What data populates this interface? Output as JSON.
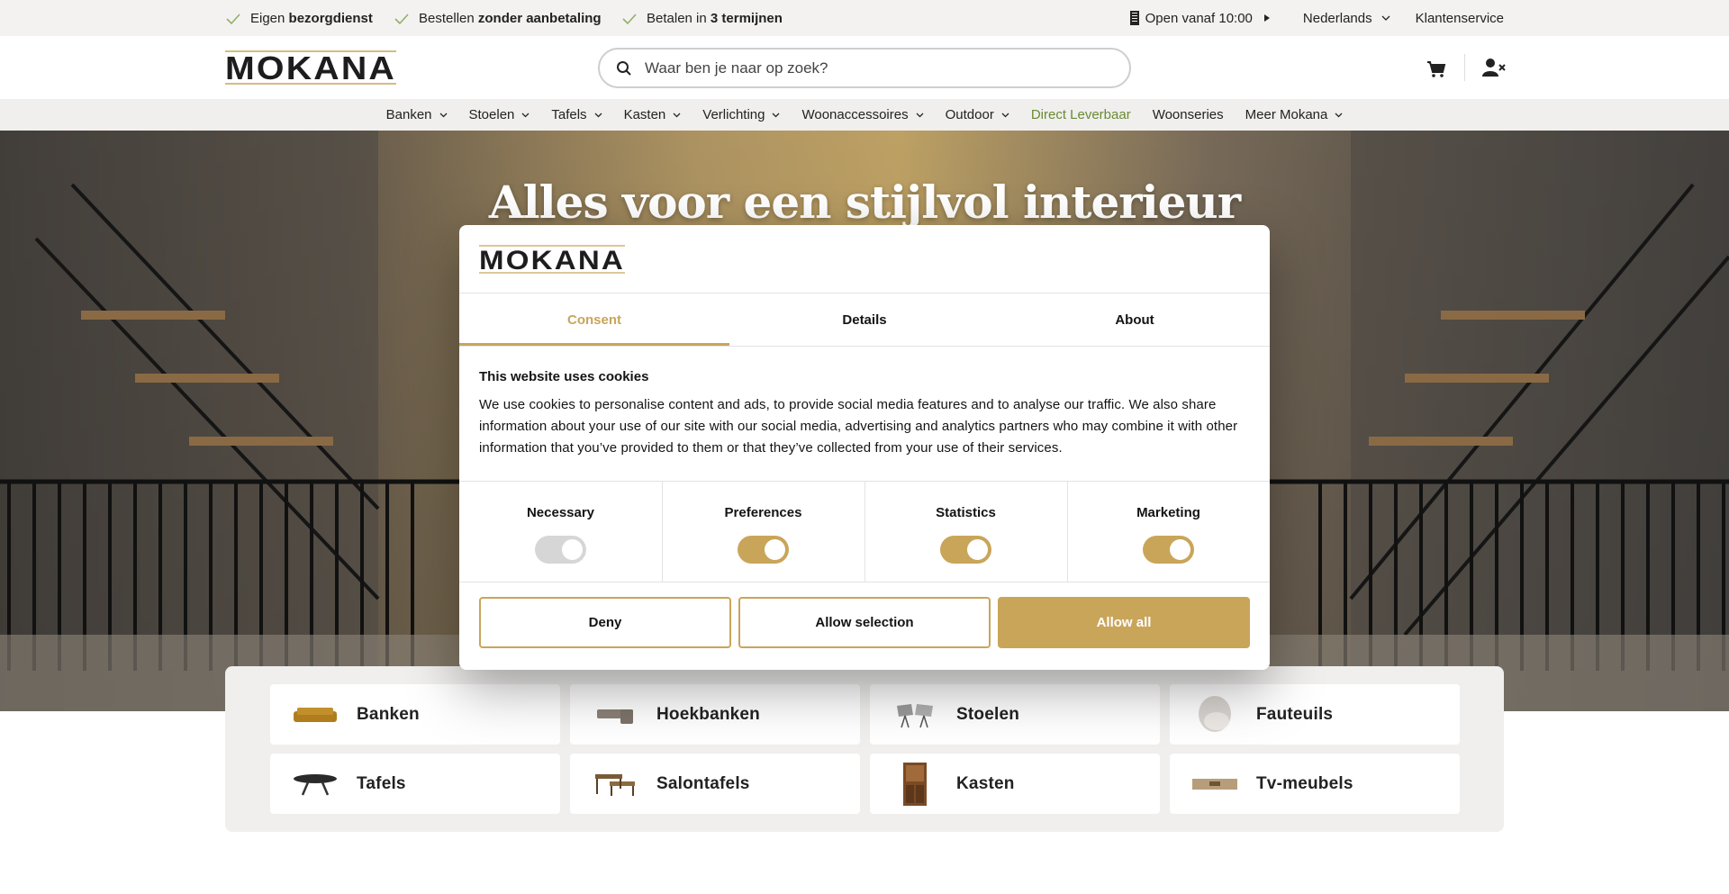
{
  "topbar": {
    "usps": [
      {
        "prefix": "Eigen ",
        "bold": "bezorgdienst"
      },
      {
        "prefix": "Bestellen ",
        "bold": "zonder aanbetaling"
      },
      {
        "prefix": "Betalen in ",
        "bold": "3 termijnen"
      }
    ],
    "opening": "Open vanaf 10:00",
    "language": "Nederlands",
    "service": "Klantenservice"
  },
  "header": {
    "logo": "MOKANA",
    "search_placeholder": "Waar ben je naar op zoek?"
  },
  "nav": {
    "items": [
      {
        "label": "Banken"
      },
      {
        "label": "Stoelen"
      },
      {
        "label": "Tafels"
      },
      {
        "label": "Kasten"
      },
      {
        "label": "Verlichting"
      },
      {
        "label": "Woonaccessoires"
      },
      {
        "label": "Outdoor"
      },
      {
        "label": "Direct Leverbaar"
      },
      {
        "label": "Woonseries"
      },
      {
        "label": "Meer Mokana"
      }
    ]
  },
  "hero": {
    "title": "Alles voor een stijlvol interieur"
  },
  "categories": [
    {
      "label": "Banken",
      "icon": "sofa-icon"
    },
    {
      "label": "Hoekbanken",
      "icon": "corner-sofa-icon"
    },
    {
      "label": "Stoelen",
      "icon": "chairs-icon"
    },
    {
      "label": "Fauteuils",
      "icon": "armchair-icon"
    },
    {
      "label": "Tafels",
      "icon": "table-icon"
    },
    {
      "label": "Salontafels",
      "icon": "coffee-table-icon"
    },
    {
      "label": "Kasten",
      "icon": "cabinet-icon"
    },
    {
      "label": "Tv-meubels",
      "icon": "tv-stand-icon"
    }
  ],
  "cookie_dialog": {
    "logo": "MOKANA",
    "tabs": [
      {
        "label": "Consent"
      },
      {
        "label": "Details"
      },
      {
        "label": "About"
      }
    ],
    "heading": "This website uses cookies",
    "text": "We use cookies to personalise content and ads, to provide social media features and to analyse our traffic. We also share information about your use of our site with our social media, advertising and analytics partners who may combine it with other information that you’ve provided to them or that they’ve collected from your use of their services.",
    "toggles": [
      {
        "label": "Necessary",
        "state": "on-disabled"
      },
      {
        "label": "Preferences",
        "state": "on"
      },
      {
        "label": "Statistics",
        "state": "on"
      },
      {
        "label": "Marketing",
        "state": "on"
      }
    ],
    "buttons": {
      "deny": "Deny",
      "allow_selection": "Allow selection",
      "allow_all": "Allow all"
    }
  },
  "colors": {
    "accent": "#c9a55a",
    "nav_highlight": "#6a8a35",
    "topbar_bg": "#f3f2f0"
  }
}
